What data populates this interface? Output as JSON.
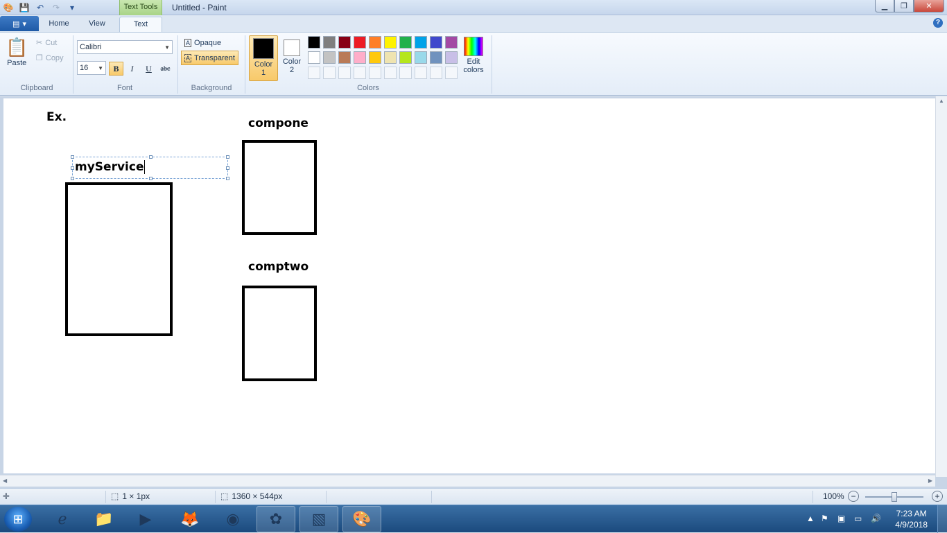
{
  "window": {
    "context_tab": "Text Tools",
    "title": "Untitled - Paint"
  },
  "tabs": [
    {
      "label": "Home"
    },
    {
      "label": "View"
    },
    {
      "label": "Text"
    }
  ],
  "ribbon": {
    "clipboard": {
      "paste": "Paste",
      "cut": "Cut",
      "copy": "Copy",
      "group": "Clipboard"
    },
    "font": {
      "family": "Calibri",
      "size": "16",
      "bold": "B",
      "italic": "I",
      "underline": "U",
      "strike": "abc",
      "group": "Font"
    },
    "background": {
      "opaque": "Opaque",
      "transparent": "Transparent",
      "group": "Background"
    },
    "colors": {
      "color1": "Color 1",
      "color2": "Color 2",
      "edit": "Edit colors",
      "group": "Colors",
      "color1_value": "#000000",
      "color2_value": "#ffffff",
      "palette_row1": [
        "#000000",
        "#7f7f7f",
        "#880015",
        "#ed1c24",
        "#ff7f27",
        "#fff200",
        "#22b14c",
        "#00a2e8",
        "#3f48cc",
        "#a349a4"
      ],
      "palette_row2": [
        "#ffffff",
        "#c3c3c3",
        "#b97a57",
        "#ffaec9",
        "#ffc90e",
        "#efe4b0",
        "#b5e61d",
        "#99d9ea",
        "#7092be",
        "#c8bfe7"
      ]
    }
  },
  "canvas": {
    "label_ex": "Ex.",
    "text_editing": "myService",
    "label_compone": "compone",
    "label_comptwo": "comptwo"
  },
  "status": {
    "selection": "1 × 1px",
    "canvas_size": "1360 × 544px",
    "zoom": "100%"
  },
  "taskbar": {
    "time": "7:23 AM",
    "date": "4/9/2018"
  }
}
